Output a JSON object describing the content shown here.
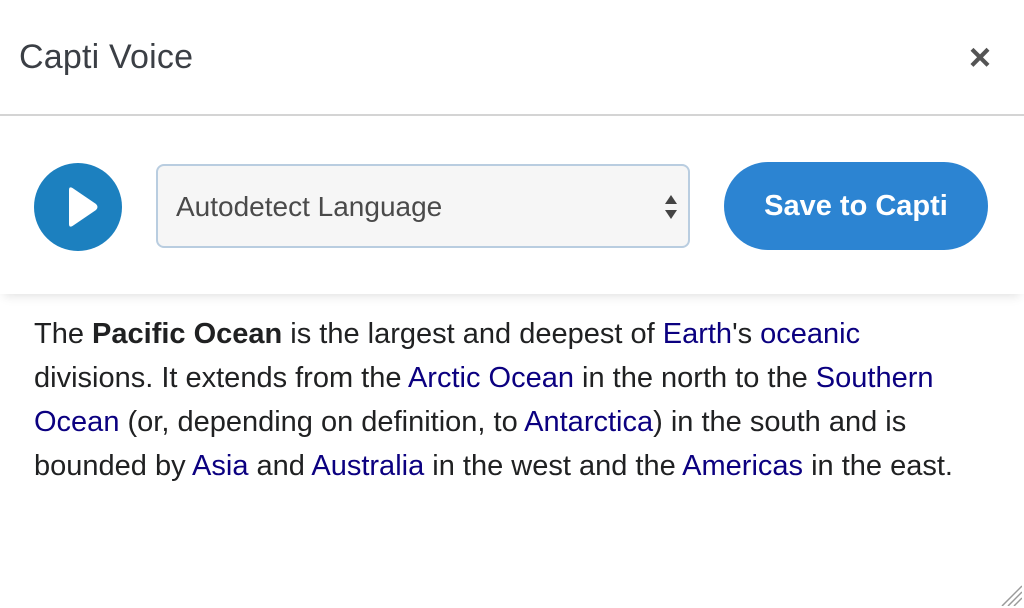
{
  "dialog": {
    "title": "Capti Voice",
    "close_label": "×"
  },
  "toolbar": {
    "play_icon": "play-icon",
    "language_select": {
      "selected": "Autodetect Language"
    },
    "save_label": "Save to Capti"
  },
  "colors": {
    "play_button": "#1c80bf",
    "save_button": "#2c84d2",
    "link": "#0b0080",
    "text": "#202122"
  },
  "article": {
    "t1": "The ",
    "bold1": "Pacific Ocean",
    "t2": " is the largest and deepest of ",
    "link_earth": "Earth",
    "t3": "'s ",
    "link_oceanic": "oceanic",
    "t4": " divisions. It extends from the ",
    "link_arctic": "Arctic Ocean",
    "t5": " in the north to the ",
    "link_southern": "Southern Ocean",
    "t6": " (or, depending on definition, to ",
    "link_antarctica": "Antarctica",
    "t7": ") in the south and is bounded by ",
    "link_asia": "Asia",
    "t8": " and ",
    "link_australia": "Australia",
    "t9": " in the west and the ",
    "link_americas": "Americas",
    "t10": " in the east."
  }
}
